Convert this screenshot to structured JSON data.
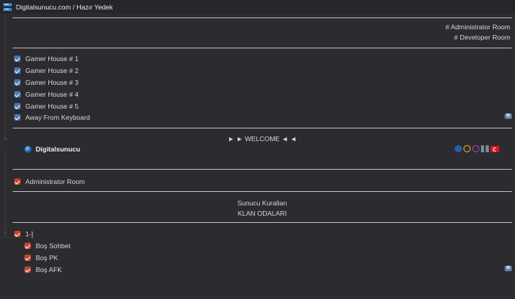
{
  "window": {
    "title": "Digitalsunucu.com / Hazır Yedek"
  },
  "top_channels": [
    "# Administrator Room",
    "# Developer Room"
  ],
  "gamer_channels": [
    "Gamer House # 1",
    "Gamer House # 2",
    "Gamer House # 3",
    "Gamer House # 4",
    "Gamer House # 5",
    "Away From Keyboard"
  ],
  "welcome": {
    "label": "► ► WELCOME ◄ ◄"
  },
  "client": {
    "name": "Digitalsunucu",
    "icons": [
      "away-icon",
      "headset-icon",
      "headset-icon",
      "mic-icon",
      "mic-icon",
      "turkey-flag-icon"
    ]
  },
  "admin_channel": {
    "label": "Administrator Room"
  },
  "rules": {
    "line1": "Sunucu Kuralları",
    "line2": "KLAN ODALARI"
  },
  "clan": {
    "label": "1-]",
    "subchannels": [
      "Boş Sohbet",
      "Boş PK",
      "Boş AFK"
    ]
  },
  "badge": {
    "label": "M"
  },
  "colors": {
    "background": "#2b2b30",
    "checkbox_blue": "#4a79b5",
    "checkbox_red": "#c5452f"
  }
}
